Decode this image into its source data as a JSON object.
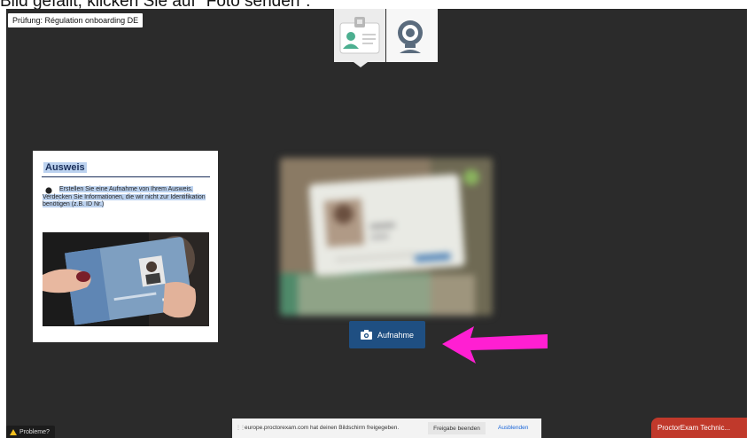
{
  "instruction_caption": "Bild gefällt, klicken Sie auf \"Foto senden\".",
  "exam": {
    "title": "Prüfung: Régulation onboarding DE"
  },
  "camera_switch": {
    "tabs": [
      {
        "icon": "id-card-icon"
      },
      {
        "icon": "webcam-icon"
      }
    ]
  },
  "id_card": {
    "heading": "Ausweis",
    "instructions": "Erstellen Sie eine Aufnahme von Ihrem Ausweis. Verdecken Sie Informationen, die wir nicht zur Identifikation benötigen (z.B. ID Nr.)",
    "sample_icon": "sample-id-photo"
  },
  "capture": {
    "label": "Aufnahme",
    "icon": "camera-icon"
  },
  "screen_share": {
    "message": "europe.proctorexam.com hat deinen Bildschirm freigegeben.",
    "stop_label": "Freigabe beenden",
    "hide_label": "Ausblenden"
  },
  "problems": {
    "label": "Probleme?"
  },
  "support_tab": {
    "label": "ProctorExam Technic..."
  },
  "colors": {
    "background": "#2b2b2b",
    "accent": "#1f4f82",
    "arrow": "#ff1fd2",
    "support": "#c0392b",
    "warning": "#f4c020"
  }
}
